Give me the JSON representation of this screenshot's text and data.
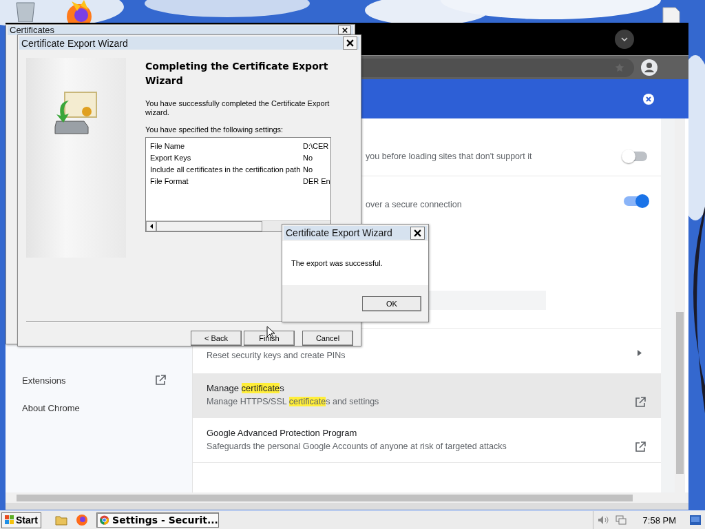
{
  "certificates_window": {
    "title": "Certificates"
  },
  "browser": {
    "sidebar": {
      "items": [
        {
          "label": "Extensions",
          "external": true
        },
        {
          "label": "About Chrome",
          "external": false
        }
      ]
    },
    "settings": [
      {
        "kind": "toggle",
        "on": false,
        "hovered": false,
        "description": [
          {
            "text": "you before loading sites that don't support it",
            "match": false
          }
        ]
      },
      {
        "kind": "toggle",
        "on": true,
        "hovered": false,
        "description": [
          {
            "text": "over a secure connection",
            "match": false
          }
        ]
      },
      {
        "kind": "submenu",
        "hovered": false,
        "description": [
          {
            "text": "Reset security keys and create PINs",
            "match": false
          }
        ]
      },
      {
        "kind": "external",
        "hovered": true,
        "title": [
          {
            "text": "Manage ",
            "match": false
          },
          {
            "text": "certificate",
            "match": true
          },
          {
            "text": "s",
            "match": false
          }
        ],
        "description": [
          {
            "text": "Manage HTTPS/SSL ",
            "match": false
          },
          {
            "text": "certificate",
            "match": true
          },
          {
            "text": "s and settings",
            "match": false
          }
        ]
      },
      {
        "kind": "external",
        "hovered": false,
        "title": [
          {
            "text": "Google Advanced Protection Program",
            "match": false
          }
        ],
        "description": [
          {
            "text": "Safeguards the personal Google Accounts of anyone at risk of targeted attacks",
            "match": false
          }
        ]
      }
    ]
  },
  "wizard": {
    "title": "Certificate Export Wizard",
    "heading": "Completing the Certificate Export Wizard",
    "intro": "You have successfully completed the Certificate Export wizard.",
    "settings_label": "You have specified the following settings:",
    "settings": [
      {
        "name": "File Name",
        "value": "D:\\CER"
      },
      {
        "name": "Export Keys",
        "value": "No"
      },
      {
        "name": "Include all certificates in the certification path",
        "value": "No"
      },
      {
        "name": "File Format",
        "value": "DER En"
      }
    ],
    "buttons": [
      "< Back",
      "Finish",
      "Cancel"
    ]
  },
  "message_box": {
    "title": "Certificate Export Wizard",
    "message": "The export was successful.",
    "button": "OK"
  },
  "taskbar": {
    "start": "Start",
    "tasks": [
      {
        "label": "Settings - Securit...",
        "selected": true
      }
    ],
    "clock": "7:58 PM"
  }
}
